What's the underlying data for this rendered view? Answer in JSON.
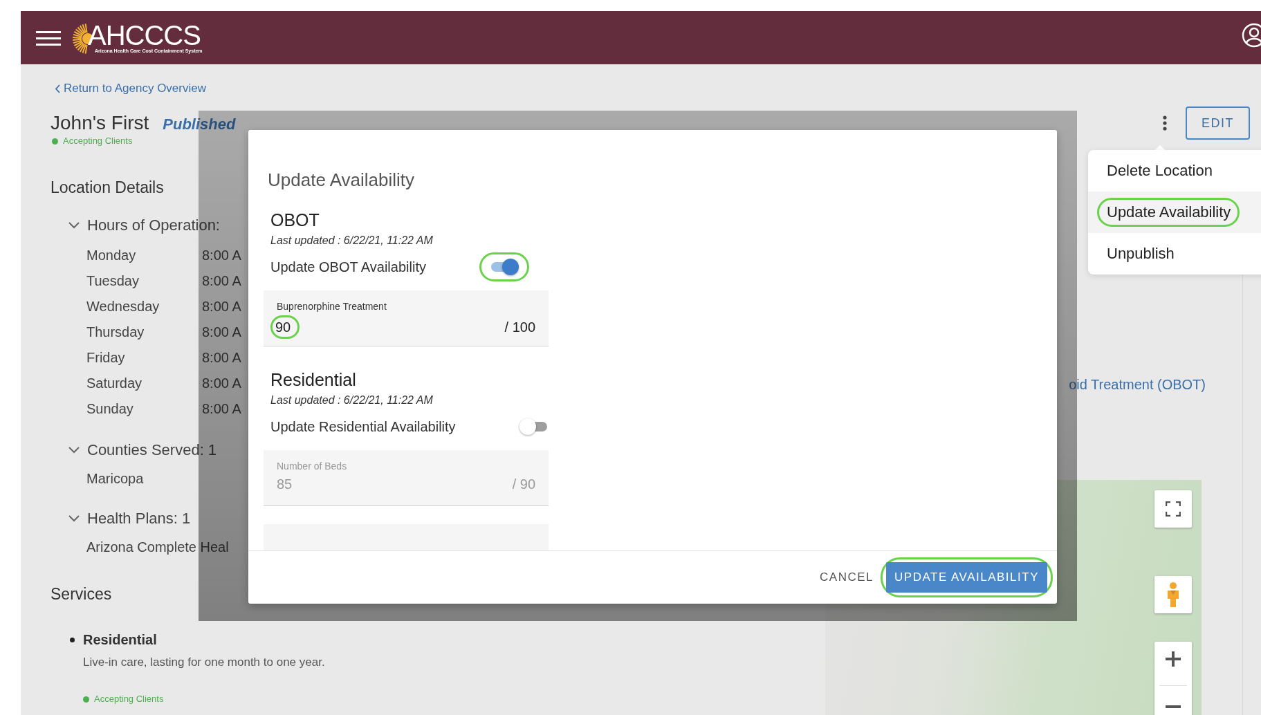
{
  "header": {
    "logo_text": "AHCCCS",
    "logo_subtitle": "Arizona Health Care Cost Containment System"
  },
  "back_link": "Return to Agency Overview",
  "location": {
    "name": "John's First",
    "status": "Published",
    "accepting": "Accepting Clients"
  },
  "actions": {
    "edit_label": "EDIT",
    "menu": [
      {
        "label": "Delete Location",
        "selected": false,
        "highlighted": false
      },
      {
        "label": "Update Availability",
        "selected": true,
        "highlighted": true
      },
      {
        "label": "Unpublish",
        "selected": false,
        "highlighted": false
      }
    ]
  },
  "location_details": {
    "title": "Location Details",
    "sections": [
      {
        "label": "Hours of Operation:",
        "expanded": true,
        "rows": [
          {
            "day": "Monday",
            "time": "8:00 A"
          },
          {
            "day": "Tuesday",
            "time": "8:00 A"
          },
          {
            "day": "Wednesday",
            "time": "8:00 A"
          },
          {
            "day": "Thursday",
            "time": "8:00 A"
          },
          {
            "day": "Friday",
            "time": "8:00 A"
          },
          {
            "day": "Saturday",
            "time": "8:00 A"
          },
          {
            "day": "Sunday",
            "time": "8:00 A"
          }
        ]
      },
      {
        "label": "Counties Served:",
        "count": "1",
        "expanded": true,
        "items": [
          "Maricopa"
        ]
      },
      {
        "label": "Health Plans:",
        "count": "1",
        "expanded": true,
        "items": [
          "Arizona Complete Heal"
        ]
      }
    ]
  },
  "services": {
    "title": "Services",
    "items": [
      {
        "name": "Residential",
        "description": "Live-in care, lasting for one month to one year.",
        "status": "Accepting Clients"
      }
    ]
  },
  "side_panel": {
    "link_text": "oid Treatment (OBOT)"
  },
  "modal": {
    "title": "Update Availability",
    "sections": [
      {
        "name": "OBOT",
        "last_updated": "Last updated : 6/22/21, 11:22 AM",
        "toggle_label": "Update OBOT Availability",
        "on": true,
        "toggle_highlighted": true,
        "field": {
          "label": "Buprenorphine Treatment",
          "value": "90",
          "max": "/ 100",
          "value_highlighted": true
        }
      },
      {
        "name": "Residential",
        "last_updated": "Last updated : 6/22/21, 11:22 AM",
        "toggle_label": "Update Residential Availability",
        "on": false,
        "toggle_highlighted": false,
        "field": {
          "label": "Number of Beds",
          "value": "85",
          "max": "/ 90",
          "value_highlighted": false
        }
      }
    ],
    "cancel": "CANCEL",
    "confirm": "UPDATE AVAILABILITY",
    "confirm_highlighted": true
  }
}
